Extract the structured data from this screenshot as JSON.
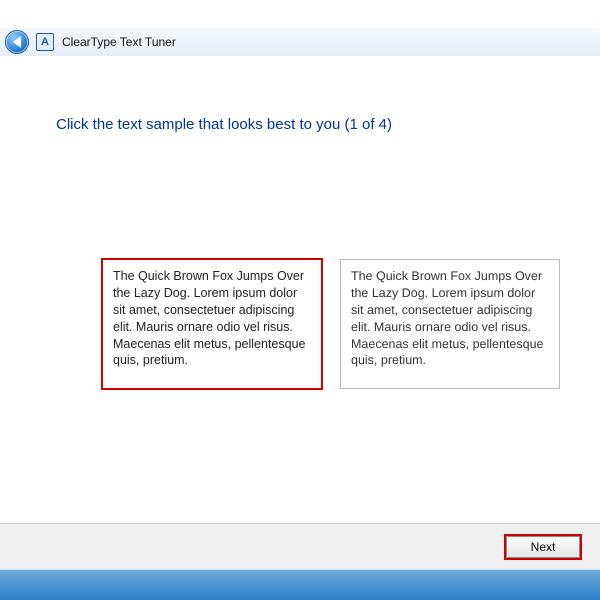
{
  "window": {
    "title": "ClearType Text Tuner",
    "icon_letter": "A"
  },
  "page": {
    "heading": "Click the text sample that looks best to you (1 of 4)"
  },
  "samples": {
    "text": "The Quick Brown Fox Jumps Over the Lazy Dog. Lorem ipsum dolor sit amet, consectetuer adipiscing elit. Mauris ornare odio vel risus. Maecenas elit metus, pellentesque quis, pretium."
  },
  "footer": {
    "next_label": "Next"
  }
}
